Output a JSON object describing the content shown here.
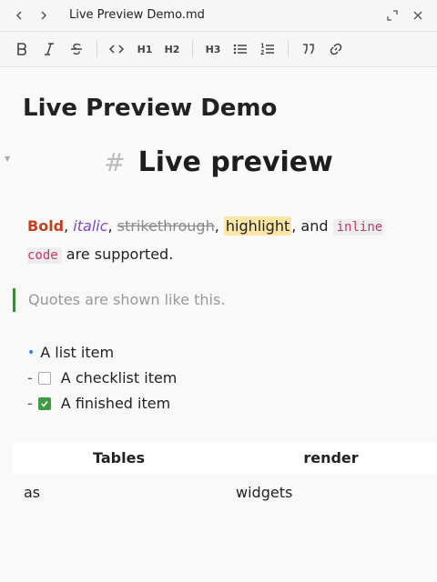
{
  "window": {
    "title": "Live Preview Demo.md",
    "back_icon": "chevron-left-icon",
    "forward_icon": "chevron-right-icon",
    "expand_icon": "expand-icon",
    "close_icon": "close-icon"
  },
  "toolbar": {
    "h1_label": "H1",
    "h2_label": "H2",
    "h3_label": "H3"
  },
  "document": {
    "title": "Live Preview Demo",
    "heading_marker": "#",
    "heading": "Live preview",
    "paragraph": {
      "bold": "Bold",
      "sep1": ", ",
      "italic": "italic",
      "sep2": ", ",
      "strike": "strikethrough",
      "sep3": ", ",
      "highlight": "highlight",
      "sep4": ", and ",
      "code": "inline code",
      "tail": " are supported."
    },
    "quote": "Quotes are shown like this.",
    "list": {
      "item1": "A list item",
      "item2_marker": "-",
      "item2": "A checklist item",
      "item3_marker": "-",
      "item3": "A finished item"
    },
    "table": {
      "headers": [
        "Tables",
        "render"
      ],
      "rows": [
        [
          "as",
          "widgets"
        ]
      ]
    }
  },
  "colors": {
    "bold": "#c2401b",
    "italic": "#7a4ac0",
    "highlight": "#fbe6a6",
    "code": "#c0395f",
    "quote_border": "#3d8a3d",
    "checkbox_checked": "#3f9b3f",
    "bullet": "#2a7fff"
  }
}
